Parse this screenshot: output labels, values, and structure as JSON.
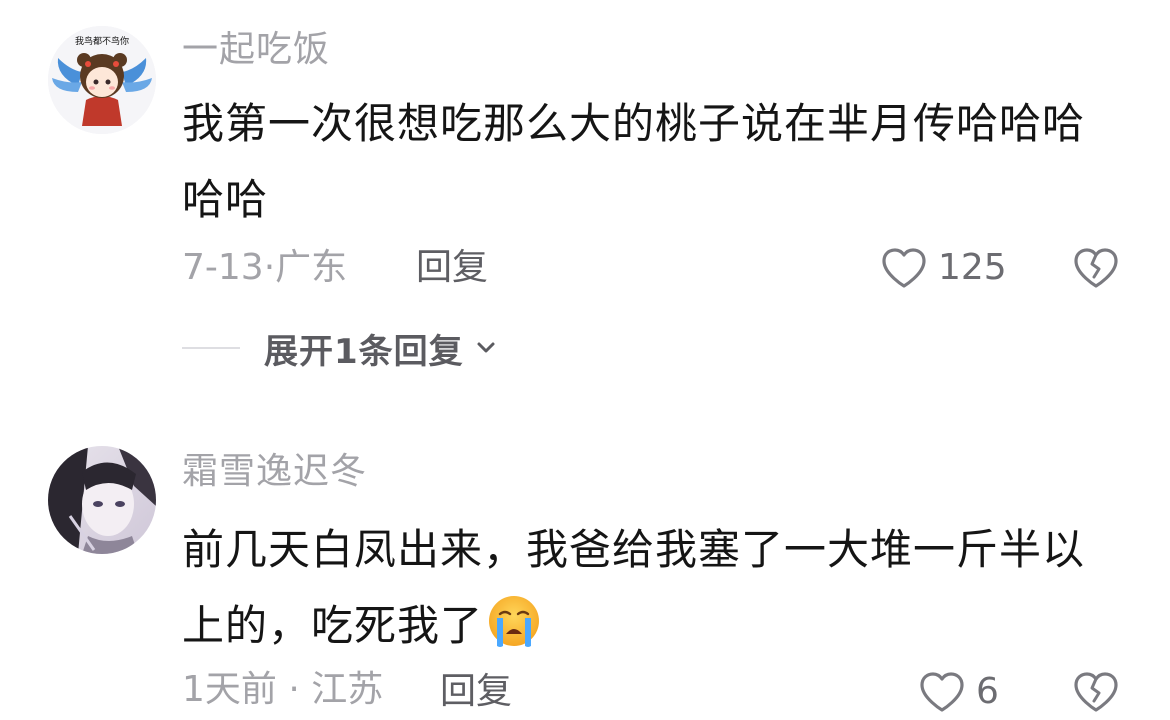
{
  "comments": [
    {
      "username": "一起吃饭",
      "avatar_badge": "我鸟都不鸟你",
      "text": "我第一次很想吃那么大的桃子说在芈月传哈哈哈哈哈",
      "date_location": "7-13·广东",
      "reply_label": "回复",
      "likes": "125",
      "expand_label": "展开1条回复"
    },
    {
      "username": "霜雪逸迟冬",
      "text": "前几天白凤出来，我爸给我塞了一大堆一斤半以上的，吃死我了",
      "emoji": "loudly-crying-face",
      "date_location": "1天前 · 江苏",
      "reply_label": "回复",
      "likes": "6"
    }
  ],
  "colors": {
    "secondary_text": "#a3a3a8",
    "primary_text": "#151515",
    "icon_gray": "#7a7a80"
  }
}
